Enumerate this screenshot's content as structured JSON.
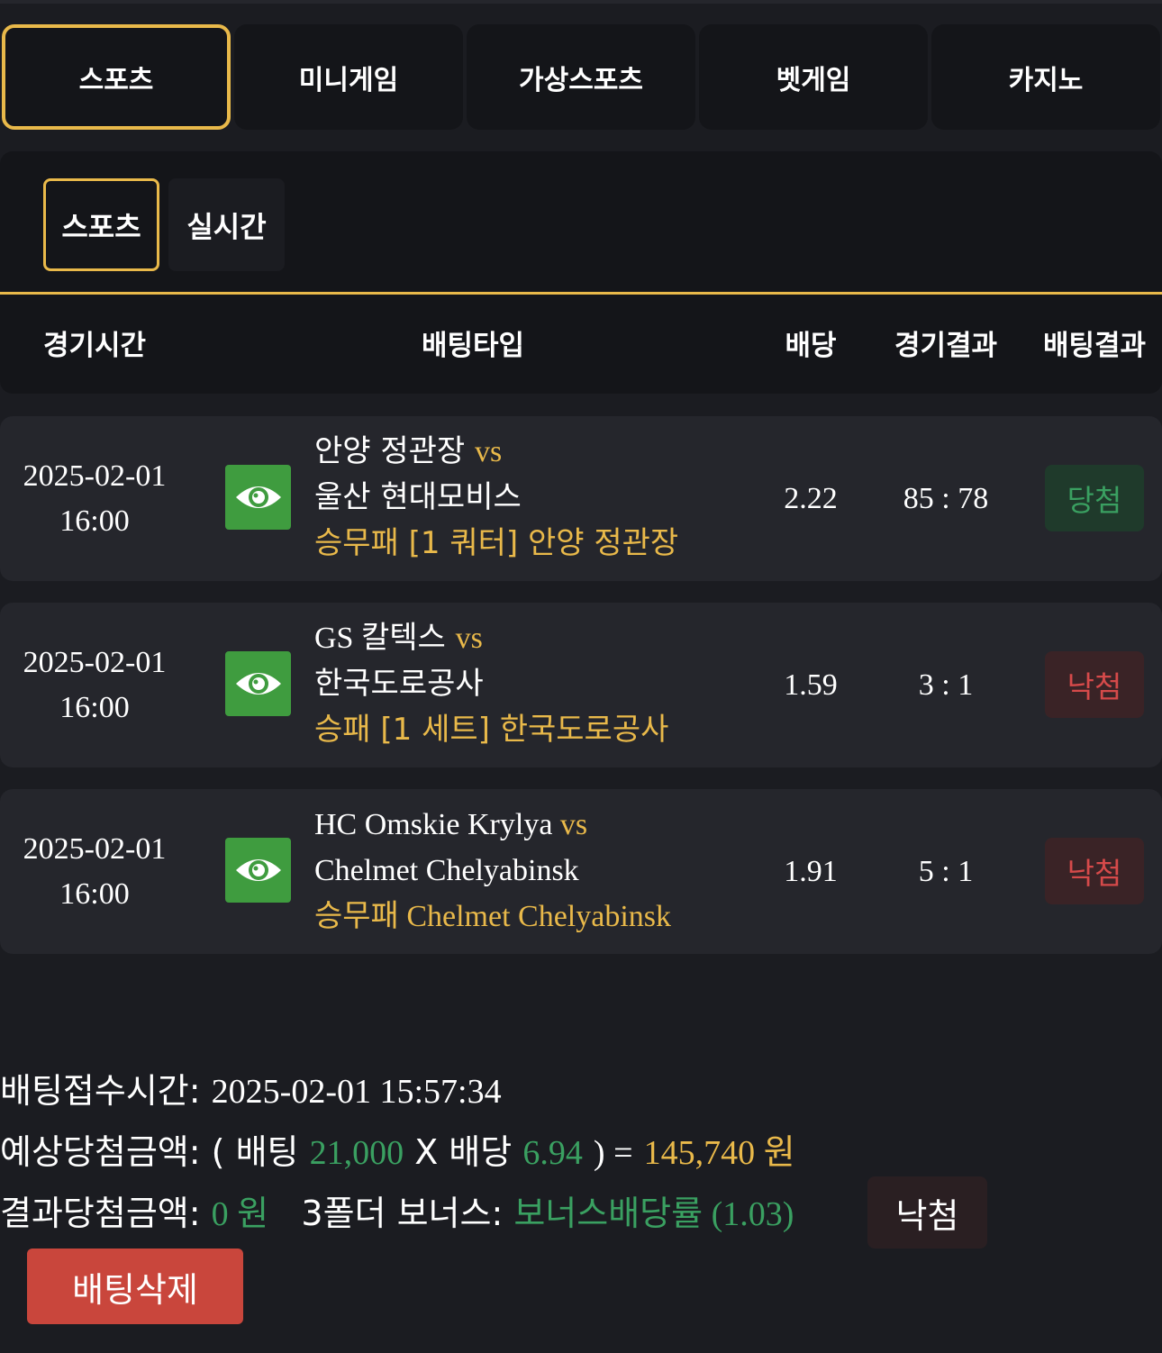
{
  "main_tabs": [
    {
      "label": "스포츠",
      "active": true
    },
    {
      "label": "미니게임",
      "active": false
    },
    {
      "label": "가상스포츠",
      "active": false
    },
    {
      "label": "벳게임",
      "active": false
    },
    {
      "label": "카지노",
      "active": false
    }
  ],
  "sub_tabs": [
    {
      "label": "스포츠",
      "active": true
    },
    {
      "label": "실시간",
      "active": false
    }
  ],
  "table": {
    "headers": [
      "경기시간",
      "배팅타입",
      "배당",
      "경기결과",
      "배팅결과"
    ],
    "rows": [
      {
        "date": "2025-02-01",
        "time": "16:00",
        "home": "안양 정관장",
        "vs": "vs",
        "away": "울산 현대모비스",
        "pick": "승무패 [1 쿼터] 안양 정관장",
        "odds": "2.22",
        "score": "85 : 78",
        "result": "당첨",
        "result_status": "win"
      },
      {
        "date": "2025-02-01",
        "time": "16:00",
        "home": "GS 칼텍스",
        "vs": "vs",
        "away": "한국도로공사",
        "pick": "승패 [1 세트] 한국도로공사",
        "odds": "1.59",
        "score": "3 : 1",
        "result": "낙첨",
        "result_status": "lose"
      },
      {
        "date": "2025-02-01",
        "time": "16:00",
        "home": "HC Omskie Krylya",
        "vs": "vs",
        "away": "Chelmet Chelyabinsk",
        "pick": "승무패 Chelmet Chelyabinsk",
        "odds": "1.91",
        "score": "5 : 1",
        "result": "낙첨",
        "result_status": "lose"
      }
    ]
  },
  "summary": {
    "accepted_label": "배팅접수시간:",
    "accepted_value": "2025-02-01 15:57:34",
    "expected_label": "예상당첨금액:",
    "expected_open": "( 배팅",
    "bet_amount": "21,000",
    "x_label": "X 배당",
    "total_odds": "6.94",
    "close_eq": ") =",
    "expected_amount": "145,740 원",
    "result_label": "결과당첨금액:",
    "result_amount": "0 원",
    "bonus_label": "3폴더 보너스:",
    "bonus_value": "보너스배당률 (1.03)",
    "status_button": "낙첨",
    "delete_button": "배팅삭제"
  },
  "colors": {
    "accent": "#e9b94a",
    "win": "#3aa061",
    "lose": "#d64a4a",
    "eye_button": "#3f9c3f",
    "delete_button": "#c9463c"
  },
  "icons": {
    "detail": "eye-icon"
  }
}
